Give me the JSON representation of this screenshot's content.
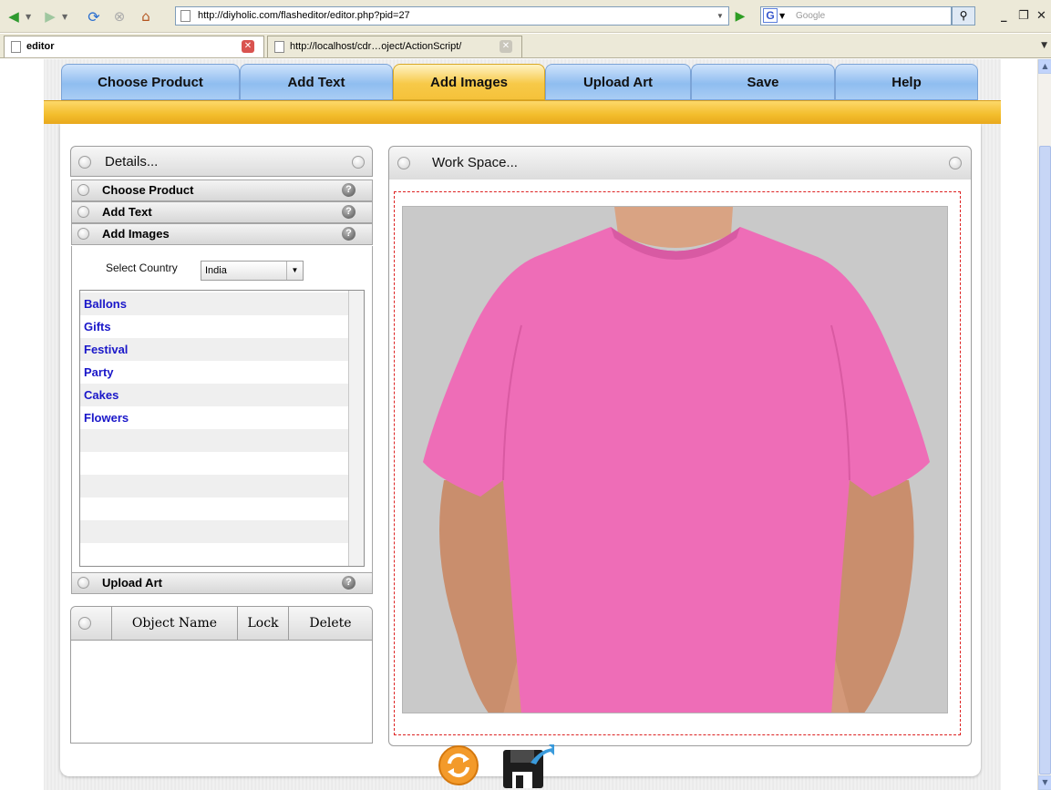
{
  "browser": {
    "url": "http://diyholic.com/flasheditor/editor.php?pid=27",
    "search_placeholder": "Google",
    "tabs": [
      {
        "label": "editor"
      },
      {
        "label": "http://localhost/cdr…oject/ActionScript/"
      }
    ]
  },
  "nav": {
    "tabs": [
      {
        "label": "Choose Product"
      },
      {
        "label": "Add Text"
      },
      {
        "label": "Add Images"
      },
      {
        "label": "Upload Art"
      },
      {
        "label": "Save"
      },
      {
        "label": "Help"
      }
    ],
    "active_index": 2
  },
  "details": {
    "title": "Details...",
    "sections": [
      {
        "label": "Choose Product",
        "help": "?"
      },
      {
        "label": "Add Text",
        "help": "?"
      },
      {
        "label": "Add Images",
        "help": "?"
      },
      {
        "label": "Upload Art",
        "help": "?"
      }
    ],
    "country_label": "Select Country",
    "country_value": "India",
    "categories": [
      "Ballons",
      "Gifts",
      "Festival",
      "Party",
      "Cakes",
      "Flowers"
    ]
  },
  "objects": {
    "columns": [
      "Object Name",
      "Lock",
      "Delete"
    ]
  },
  "workspace": {
    "title": "Work Space...",
    "shirt_color": "#ee6db7"
  },
  "colors": {
    "accent_blue": "#8fbdf0",
    "accent_gold": "#f3bd2c",
    "link_blue": "#1a17c9"
  }
}
